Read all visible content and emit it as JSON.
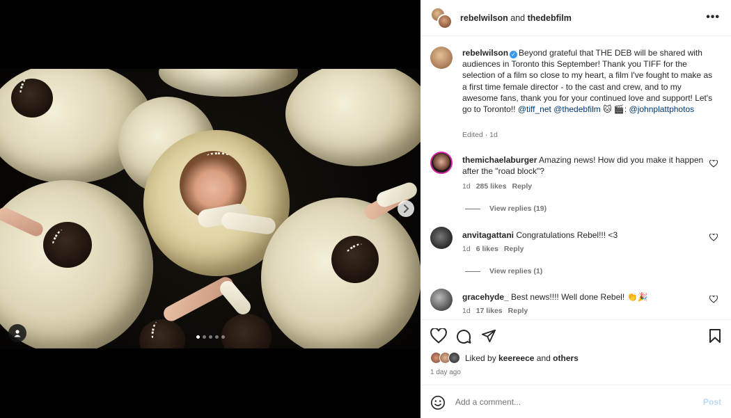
{
  "post": {
    "authors": {
      "primary": "rebelwilson",
      "joiner": "and",
      "secondary": "thedebfilm"
    },
    "more_icon": "more-horizontal-icon",
    "carousel": {
      "current": 1,
      "total": 5
    }
  },
  "caption": {
    "username": "rebelwilson",
    "text": "Beyond grateful that THE DEB will be shared with audiences in Toronto this September! Thank you TIFF for the selection of a film so close to my heart, a film I've fought to make as a first time female director - to the cast and crew, and to my awesome fans, thank you for your continued love and support! Let's go to Toronto!! ",
    "mention1": "@tiff_net",
    "mention2": "@thedebfilm",
    "emoji_tail": " 🐱 🎬: ",
    "mention3": "@johnplattphotos",
    "meta": "Edited · 1d"
  },
  "comments": [
    {
      "username": "themichaelaburger",
      "text": "Amazing news! How did you make it happen after the \"road block\"?",
      "time": "1d",
      "likes": "285 likes",
      "reply": "Reply",
      "view_replies": "View replies (19)"
    },
    {
      "username": "anvitagattani",
      "text": "Congratulations Rebel!!! <3",
      "time": "1d",
      "likes": "6 likes",
      "reply": "Reply",
      "view_replies": "View replies (1)"
    },
    {
      "username": "gracehyde_",
      "text": "Best news!!!! Well done Rebel! 👏🎉",
      "time": "1d",
      "likes": "17 likes",
      "reply": "Reply"
    }
  ],
  "liked_by": {
    "prefix": "Liked by",
    "user": "keereece",
    "joiner": "and",
    "others": "others"
  },
  "date": "1 day ago",
  "add_comment": {
    "placeholder": "Add a comment...",
    "post_label": "Post"
  },
  "colors": {
    "link": "#00376b",
    "verified": "#3897f0",
    "post_disabled": "#b8d9f8",
    "muted": "#737373"
  }
}
